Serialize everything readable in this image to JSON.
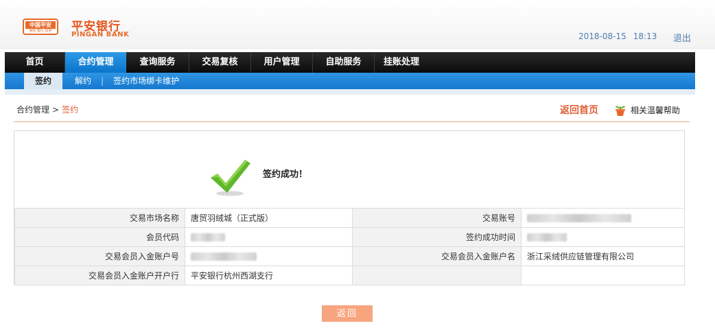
{
  "header": {
    "logo_badge_top": "中国平安",
    "logo_badge_bottom": "保险·银行·投资",
    "logo_cn": "平安银行",
    "logo_en": "PINGAN BANK",
    "date": "2018-08-15",
    "time": "18:13",
    "logout": "退出"
  },
  "main_nav": {
    "items": [
      {
        "label": "首页"
      },
      {
        "label": "合约管理"
      },
      {
        "label": "查询服务"
      },
      {
        "label": "交易复核"
      },
      {
        "label": "用户管理"
      },
      {
        "label": "自助服务"
      },
      {
        "label": "挂账处理"
      }
    ],
    "active": "合约管理"
  },
  "sub_nav": {
    "items": [
      {
        "label": "签约"
      },
      {
        "label": "解约"
      },
      {
        "label": "签约市场绑卡维护"
      }
    ],
    "separator": "|",
    "active": "签约"
  },
  "breadcrumb": {
    "parent": "合约管理",
    "arrow": ">",
    "current": "签约"
  },
  "actions": {
    "back_home": "返回首页",
    "help": "相关温馨帮助"
  },
  "result": {
    "message": "签约成功！",
    "rows": [
      {
        "label1": "交易市场名称",
        "value1": "唐贸羽绒城（正式版）",
        "label2": "交易账号",
        "value2": ""
      },
      {
        "label1": "会员代码",
        "value1": "",
        "label2": "签约成功时间",
        "value2": ""
      },
      {
        "label1": "交易会员入金账户号",
        "value1": "",
        "label2": "交易会员入金账户名",
        "value2": "浙江采绒供应链管理有限公司"
      },
      {
        "label1": "交易会员入金账户开户行",
        "value1": "平安银行杭州西湖支行",
        "label2": "",
        "value2": ""
      }
    ]
  },
  "buttons": {
    "return": "返回"
  },
  "colors": {
    "accent_orange": "#e0623a",
    "nav_active_blue": "#0b74cc",
    "success_green": "#5fb82a"
  }
}
